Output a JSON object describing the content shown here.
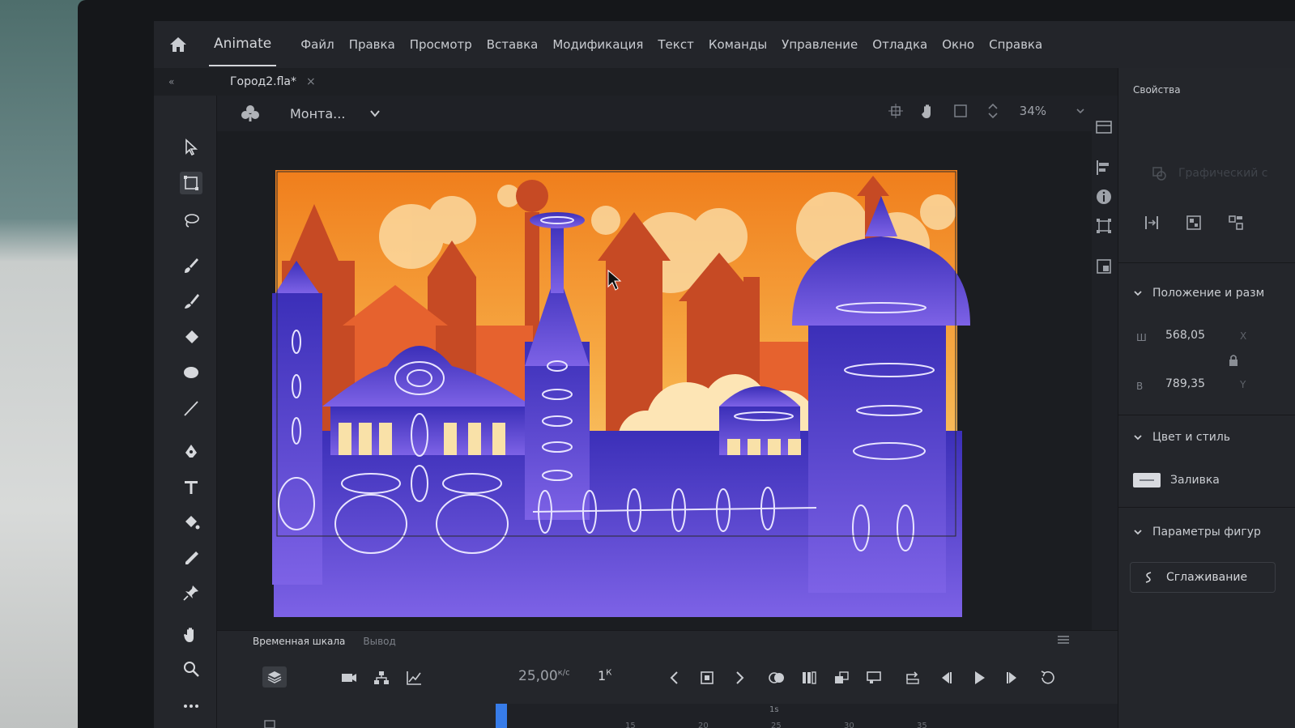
{
  "menubar": {
    "app_name": "Animate",
    "items": [
      "Файл",
      "Правка",
      "Просмотр",
      "Вставка",
      "Модификация",
      "Текст",
      "Команды",
      "Управление",
      "Отладка",
      "Окно",
      "Справка"
    ]
  },
  "document": {
    "tab_title": "Город2.fla*",
    "close_symbol": "×"
  },
  "stage_toolbar": {
    "scene_label": "Монта...",
    "zoom": "34%"
  },
  "toolbox": {
    "tools": [
      "selection-tool",
      "free-transform-tool",
      "lasso-tool",
      "paint-brush-tool",
      "brush-tool",
      "eraser-tool",
      "oval-tool",
      "line-tool",
      "pen-tool",
      "text-tool",
      "paint-bucket-tool",
      "eyedropper-tool",
      "pin-tool",
      "hand-tool",
      "zoom-tool",
      "more-tools"
    ]
  },
  "properties": {
    "title": "Свойства",
    "object_type": "Графический с",
    "position_section": "Положение и разм",
    "width_label": "Ш",
    "width_value": "568,05",
    "height_label": "В",
    "height_value": "789,35",
    "x_label": "X",
    "y_label": "Y",
    "color_section": "Цвет и стиль",
    "fill_label": "Заливка",
    "shape_section": "Параметры фигур",
    "smoothing_label": "Сглаживание"
  },
  "timeline": {
    "tab_timeline": "Временная шкала",
    "tab_output": "Вывод",
    "fps_value": "25,00",
    "fps_unit": "к/с",
    "frame_value": "1",
    "frame_unit": "К",
    "ruler_ticks": [
      "15",
      "20",
      "25",
      "30",
      "35"
    ],
    "ruler_second": "1s"
  },
  "colors": {
    "accent": "#3a86ff",
    "sky_orange": "#f28a1e",
    "city_purple": "#4a3bc4",
    "city_violet": "#7a5de0"
  }
}
